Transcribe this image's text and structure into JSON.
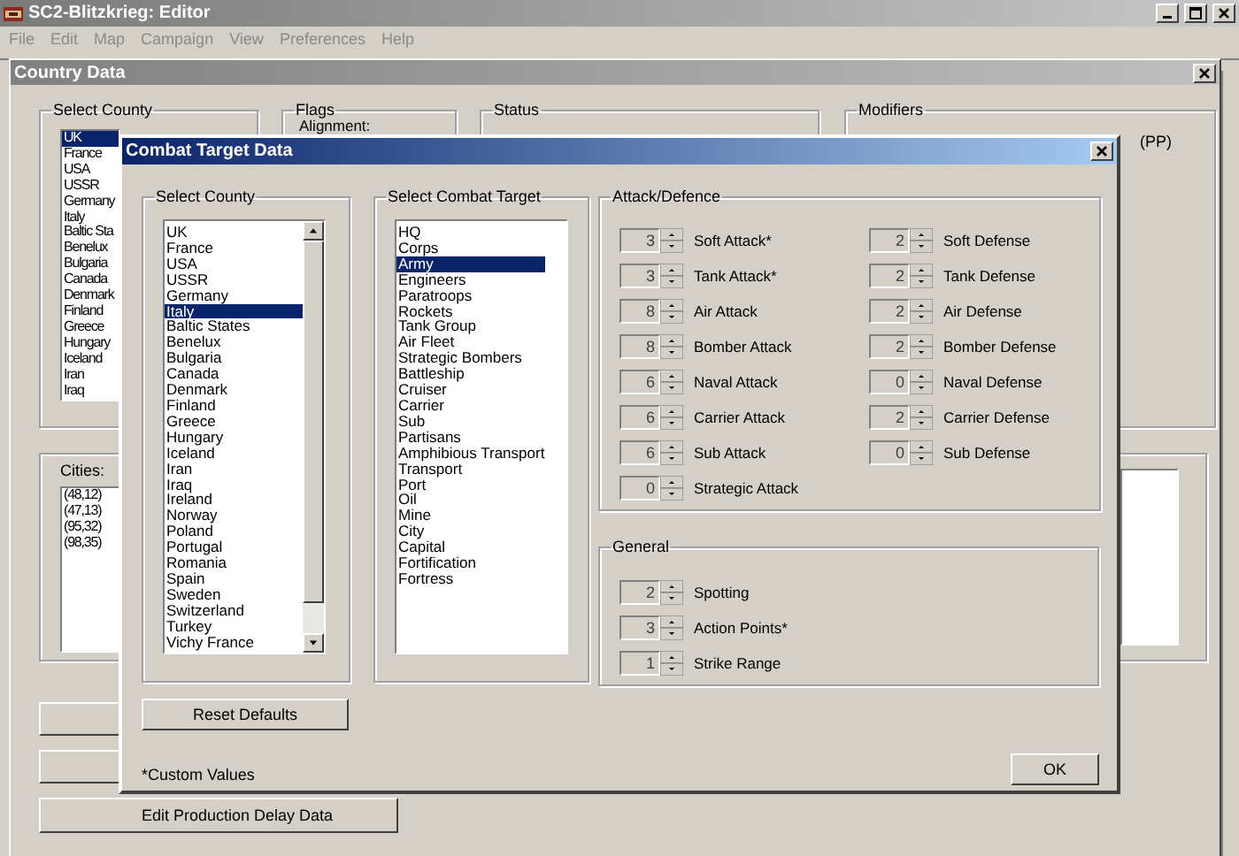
{
  "editor": {
    "title": "SC2-Blitzkrieg: Editor",
    "menu": [
      "File",
      "Edit",
      "Map",
      "Campaign",
      "View",
      "Preferences",
      "Help"
    ]
  },
  "country_data": {
    "title": "Country Data",
    "select_country": {
      "label": "Select County",
      "items": [
        {
          "label": "UK",
          "selected": true
        },
        {
          "label": "France",
          "selected": false
        },
        {
          "label": "USA",
          "selected": false
        },
        {
          "label": "USSR",
          "selected": false
        },
        {
          "label": "Germany",
          "selected": false
        },
        {
          "label": "Italy",
          "selected": false
        },
        {
          "label": "Baltic Sta",
          "selected": false
        },
        {
          "label": "Benelux",
          "selected": false
        },
        {
          "label": "Bulgaria",
          "selected": false
        },
        {
          "label": "Canada",
          "selected": false
        },
        {
          "label": "Denmark",
          "selected": false
        },
        {
          "label": "Finland",
          "selected": false
        },
        {
          "label": "Greece",
          "selected": false
        },
        {
          "label": "Hungary",
          "selected": false
        },
        {
          "label": "Iceland",
          "selected": false
        },
        {
          "label": "Iran",
          "selected": false
        },
        {
          "label": "Iraq",
          "selected": false
        }
      ]
    },
    "flags": {
      "label": "Flags",
      "alignment_label": "Alignment:"
    },
    "status": {
      "label": "Status"
    },
    "modifiers": {
      "label": "Modifiers",
      "fragment": "(PP)"
    },
    "cities": {
      "label": "Cities:",
      "items": [
        "(48,12)",
        "(47,13)",
        "(95,32)",
        "(98,35)"
      ]
    },
    "edit_button": "Edit Production Delay Data"
  },
  "dialog": {
    "title": "Combat Target Data",
    "country": {
      "label": "Select County",
      "items": [
        {
          "label": "UK",
          "selected": false
        },
        {
          "label": "France",
          "selected": false
        },
        {
          "label": "USA",
          "selected": false
        },
        {
          "label": "USSR",
          "selected": false
        },
        {
          "label": "Germany",
          "selected": false
        },
        {
          "label": "Italy",
          "selected": true
        },
        {
          "label": "Baltic States",
          "selected": false
        },
        {
          "label": "Benelux",
          "selected": false
        },
        {
          "label": "Bulgaria",
          "selected": false
        },
        {
          "label": "Canada",
          "selected": false
        },
        {
          "label": "Denmark",
          "selected": false
        },
        {
          "label": "Finland",
          "selected": false
        },
        {
          "label": "Greece",
          "selected": false
        },
        {
          "label": "Hungary",
          "selected": false
        },
        {
          "label": "Iceland",
          "selected": false
        },
        {
          "label": "Iran",
          "selected": false
        },
        {
          "label": "Iraq",
          "selected": false
        },
        {
          "label": "Ireland",
          "selected": false
        },
        {
          "label": "Norway",
          "selected": false
        },
        {
          "label": "Poland",
          "selected": false
        },
        {
          "label": "Portugal",
          "selected": false
        },
        {
          "label": "Romania",
          "selected": false
        },
        {
          "label": "Spain",
          "selected": false
        },
        {
          "label": "Sweden",
          "selected": false
        },
        {
          "label": "Switzerland",
          "selected": false
        },
        {
          "label": "Turkey",
          "selected": false
        },
        {
          "label": "Vichy France",
          "selected": false
        }
      ]
    },
    "target": {
      "label": "Select Combat Target",
      "items": [
        {
          "label": "HQ",
          "selected": false
        },
        {
          "label": "Corps",
          "selected": false
        },
        {
          "label": "Army",
          "selected": true
        },
        {
          "label": "Engineers",
          "selected": false
        },
        {
          "label": "Paratroops",
          "selected": false
        },
        {
          "label": "Rockets",
          "selected": false
        },
        {
          "label": "Tank Group",
          "selected": false
        },
        {
          "label": "Air Fleet",
          "selected": false
        },
        {
          "label": "Strategic Bombers",
          "selected": false
        },
        {
          "label": "Battleship",
          "selected": false
        },
        {
          "label": "Cruiser",
          "selected": false
        },
        {
          "label": "Carrier",
          "selected": false
        },
        {
          "label": "Sub",
          "selected": false
        },
        {
          "label": "Partisans",
          "selected": false
        },
        {
          "label": "Amphibious Transport",
          "selected": false
        },
        {
          "label": "Transport",
          "selected": false
        },
        {
          "label": "Port",
          "selected": false
        },
        {
          "label": "Oil",
          "selected": false
        },
        {
          "label": "Mine",
          "selected": false
        },
        {
          "label": "City",
          "selected": false
        },
        {
          "label": "Capital",
          "selected": false
        },
        {
          "label": "Fortification",
          "selected": false
        },
        {
          "label": "Fortress",
          "selected": false
        }
      ]
    },
    "reset_button": "Reset Defaults",
    "note": "*Custom Values",
    "attack_defence": {
      "label": "Attack/Defence",
      "attacks": [
        {
          "value": "3",
          "label": "Soft Attack*"
        },
        {
          "value": "3",
          "label": "Tank Attack*"
        },
        {
          "value": "8",
          "label": "Air Attack"
        },
        {
          "value": "8",
          "label": "Bomber Attack"
        },
        {
          "value": "6",
          "label": "Naval Attack"
        },
        {
          "value": "6",
          "label": "Carrier Attack"
        },
        {
          "value": "6",
          "label": "Sub Attack"
        },
        {
          "value": "0",
          "label": "Strategic Attack"
        }
      ],
      "defenses": [
        {
          "value": "2",
          "label": "Soft Defense"
        },
        {
          "value": "2",
          "label": "Tank Defense"
        },
        {
          "value": "2",
          "label": "Air Defense"
        },
        {
          "value": "2",
          "label": "Bomber Defense"
        },
        {
          "value": "0",
          "label": "Naval Defense"
        },
        {
          "value": "2",
          "label": "Carrier Defense"
        },
        {
          "value": "0",
          "label": "Sub Defense"
        }
      ]
    },
    "general": {
      "label": "General",
      "rows": [
        {
          "value": "2",
          "label": "Spotting"
        },
        {
          "value": "3",
          "label": "Action Points*"
        },
        {
          "value": "1",
          "label": "Strike Range"
        }
      ]
    },
    "ok_button": "OK"
  }
}
